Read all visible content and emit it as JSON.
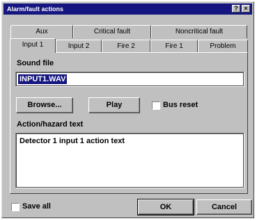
{
  "window": {
    "title": "Alarm/fault actions",
    "help_glyph": "?",
    "close_glyph": "×"
  },
  "tabs": {
    "back_row": [
      "Aux",
      "Critical fault",
      "Noncritical fault"
    ],
    "front_row": [
      "Input 1",
      "Input 2",
      "Fire 2",
      "Fire 1",
      "Problem"
    ],
    "active": "Input 1"
  },
  "sound": {
    "label": "Sound file",
    "value": "INPUT1.WAV"
  },
  "buttons": {
    "browse": "Browse...",
    "play": "Play",
    "ok": "OK",
    "cancel": "Cancel"
  },
  "checkboxes": {
    "bus_reset": "Bus reset",
    "save_all": "Save all"
  },
  "action_text": {
    "label": "Action/hazard text",
    "value": "Detector 1 input 1 action text"
  }
}
